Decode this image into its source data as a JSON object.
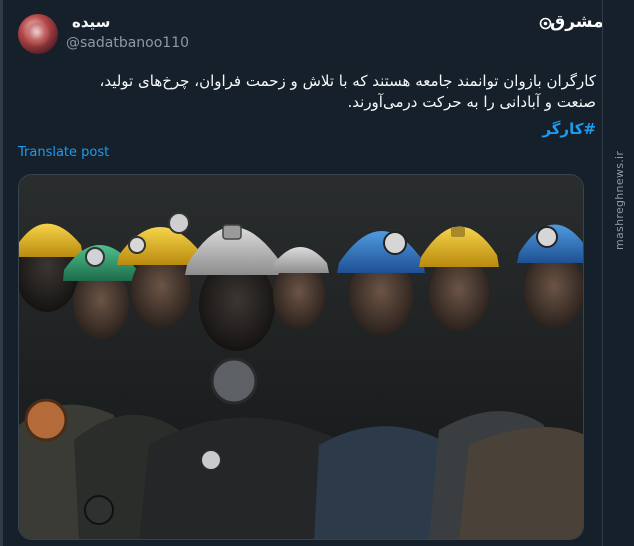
{
  "post": {
    "display_name": "سیده",
    "handle": "@sadatbanoo110",
    "text_line1": "کارگران بازوان توانمند جامعه هستند که با تلاش و زحمت فراوان، چرخ‌های تولید،",
    "text_line2": "صنعت و آبادانی را به حرکت درمی‌آورند.",
    "hashtag": "#کارگر",
    "translate_label": "Translate post"
  },
  "watermark": {
    "logo": "مشرق",
    "site": "mashreghnews.ir"
  },
  "media": {
    "subject": "coal miners in helmets"
  },
  "colors": {
    "background": "#15202b",
    "link": "#1d9bf0",
    "secondary_text": "#8b98a5"
  }
}
